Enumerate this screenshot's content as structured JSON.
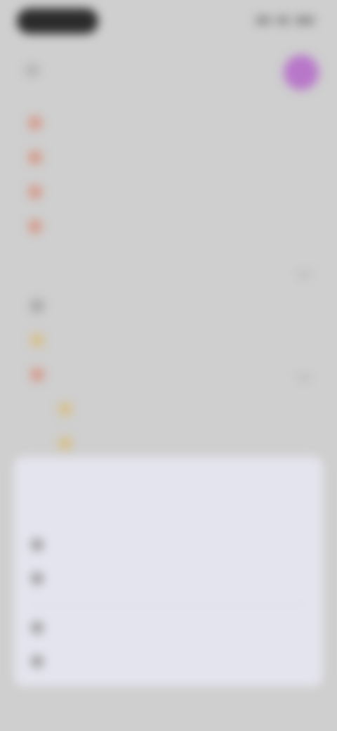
{
  "header": {
    "title": ""
  },
  "nav": {
    "items": [
      {
        "label": ""
      },
      {
        "label": ""
      },
      {
        "label": ""
      },
      {
        "label": ""
      }
    ]
  },
  "section": {
    "label": ""
  },
  "tree": {
    "rows": [
      {
        "label": ""
      },
      {
        "label": ""
      },
      {
        "label": ""
      },
      {
        "label": ""
      },
      {
        "label": ""
      }
    ]
  },
  "sheet": {
    "title": "",
    "options": [
      {
        "label": ""
      },
      {
        "label": ""
      },
      {
        "label": ""
      },
      {
        "label": ""
      }
    ]
  },
  "colors": {
    "background": "#cfcfcf",
    "accent": "#7a7ad0",
    "avatar": "#b877c9",
    "sheet": "#e4e4ee"
  }
}
